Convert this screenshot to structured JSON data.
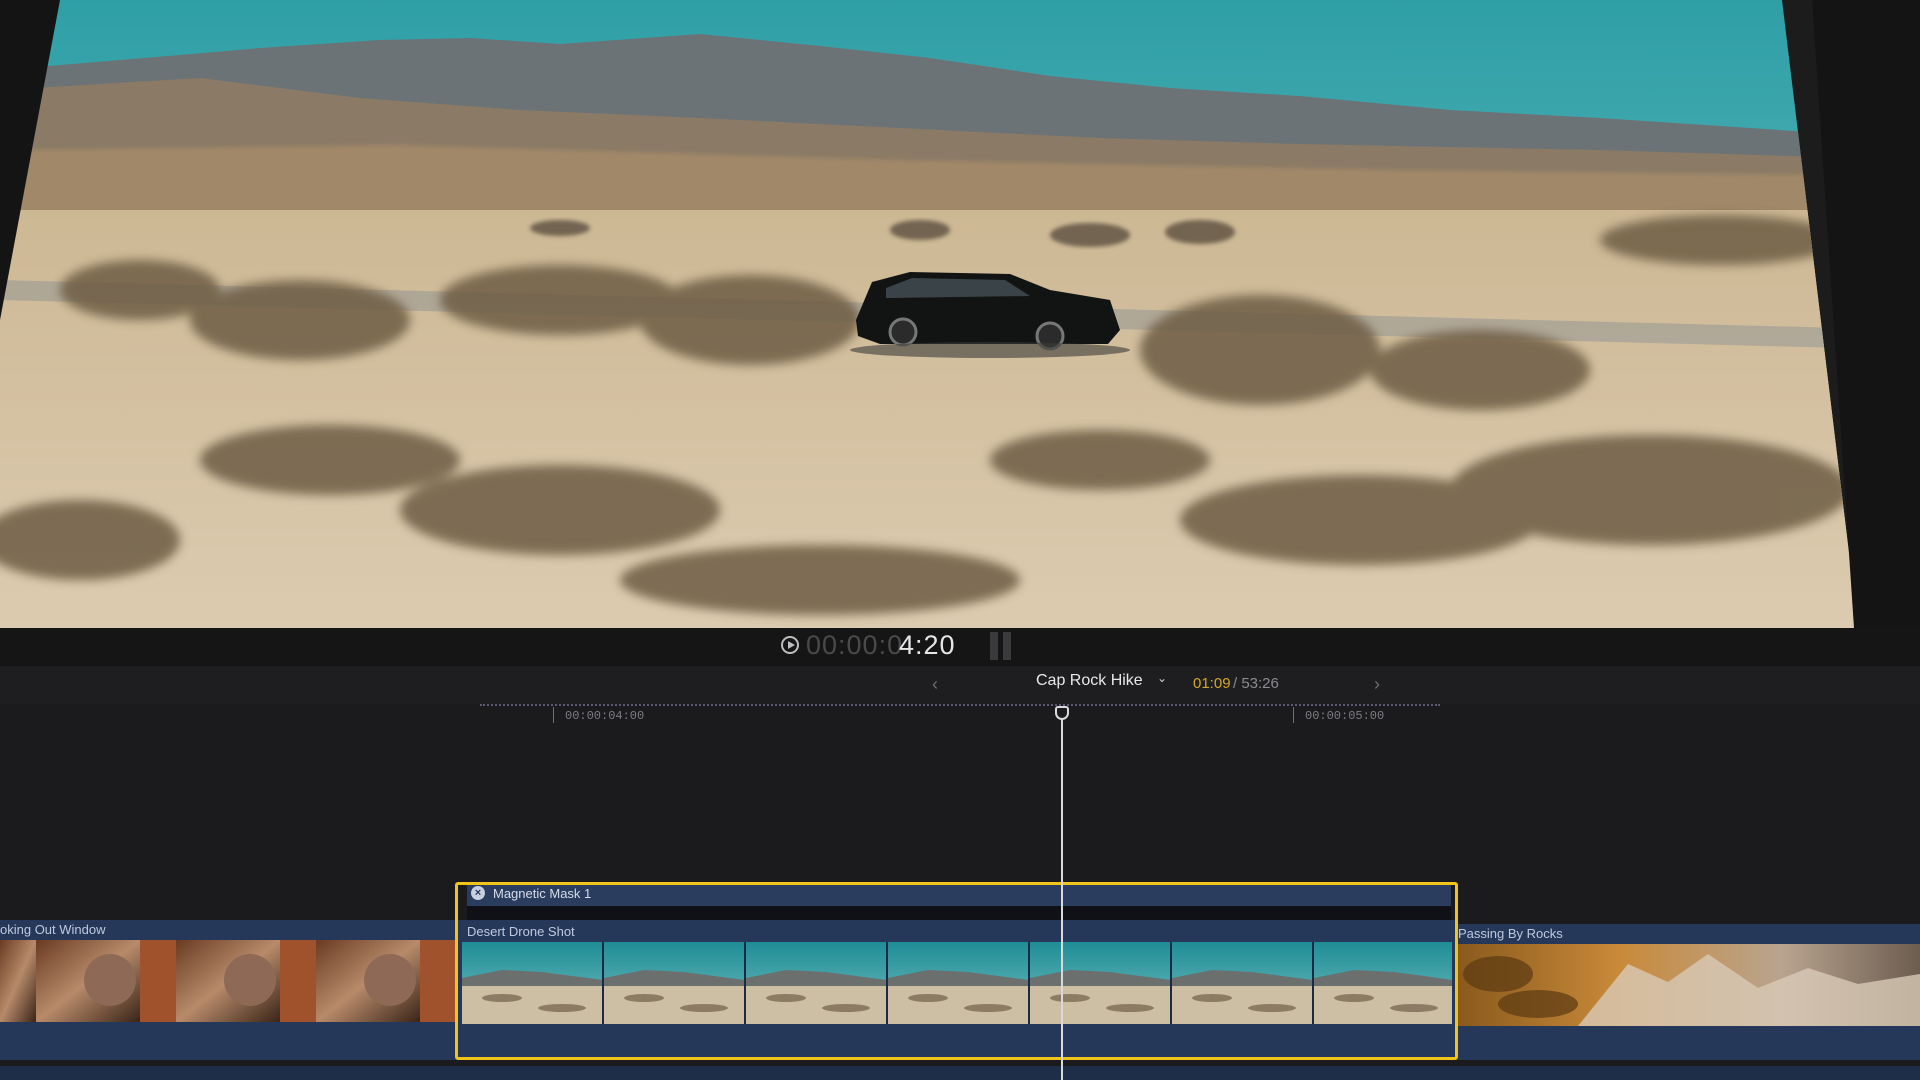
{
  "viewer": {
    "timecode_dim": "00:00:0",
    "timecode_bright": "4:20"
  },
  "project_bar": {
    "project_name": "Cap Rock Hike",
    "current_time": "01:09",
    "separator_duration": "/ 53:26"
  },
  "ruler": {
    "labels": [
      "00:00:04:00",
      "00:00:05:00"
    ]
  },
  "timeline": {
    "mask": {
      "label": "Magnetic Mask 1"
    },
    "clips": [
      {
        "label": "oking Out Window"
      },
      {
        "label": "Desert Drone Shot"
      },
      {
        "label": "Passing By Rocks"
      }
    ]
  },
  "colors": {
    "selection": "#f0c419",
    "clip_blue": "#25385a",
    "time_accent": "#d3a62a"
  },
  "icons": [
    "play-icon",
    "chevron-left-icon",
    "chevron-down-icon",
    "chevron-right-icon",
    "close-icon",
    "playhead-icon"
  ]
}
